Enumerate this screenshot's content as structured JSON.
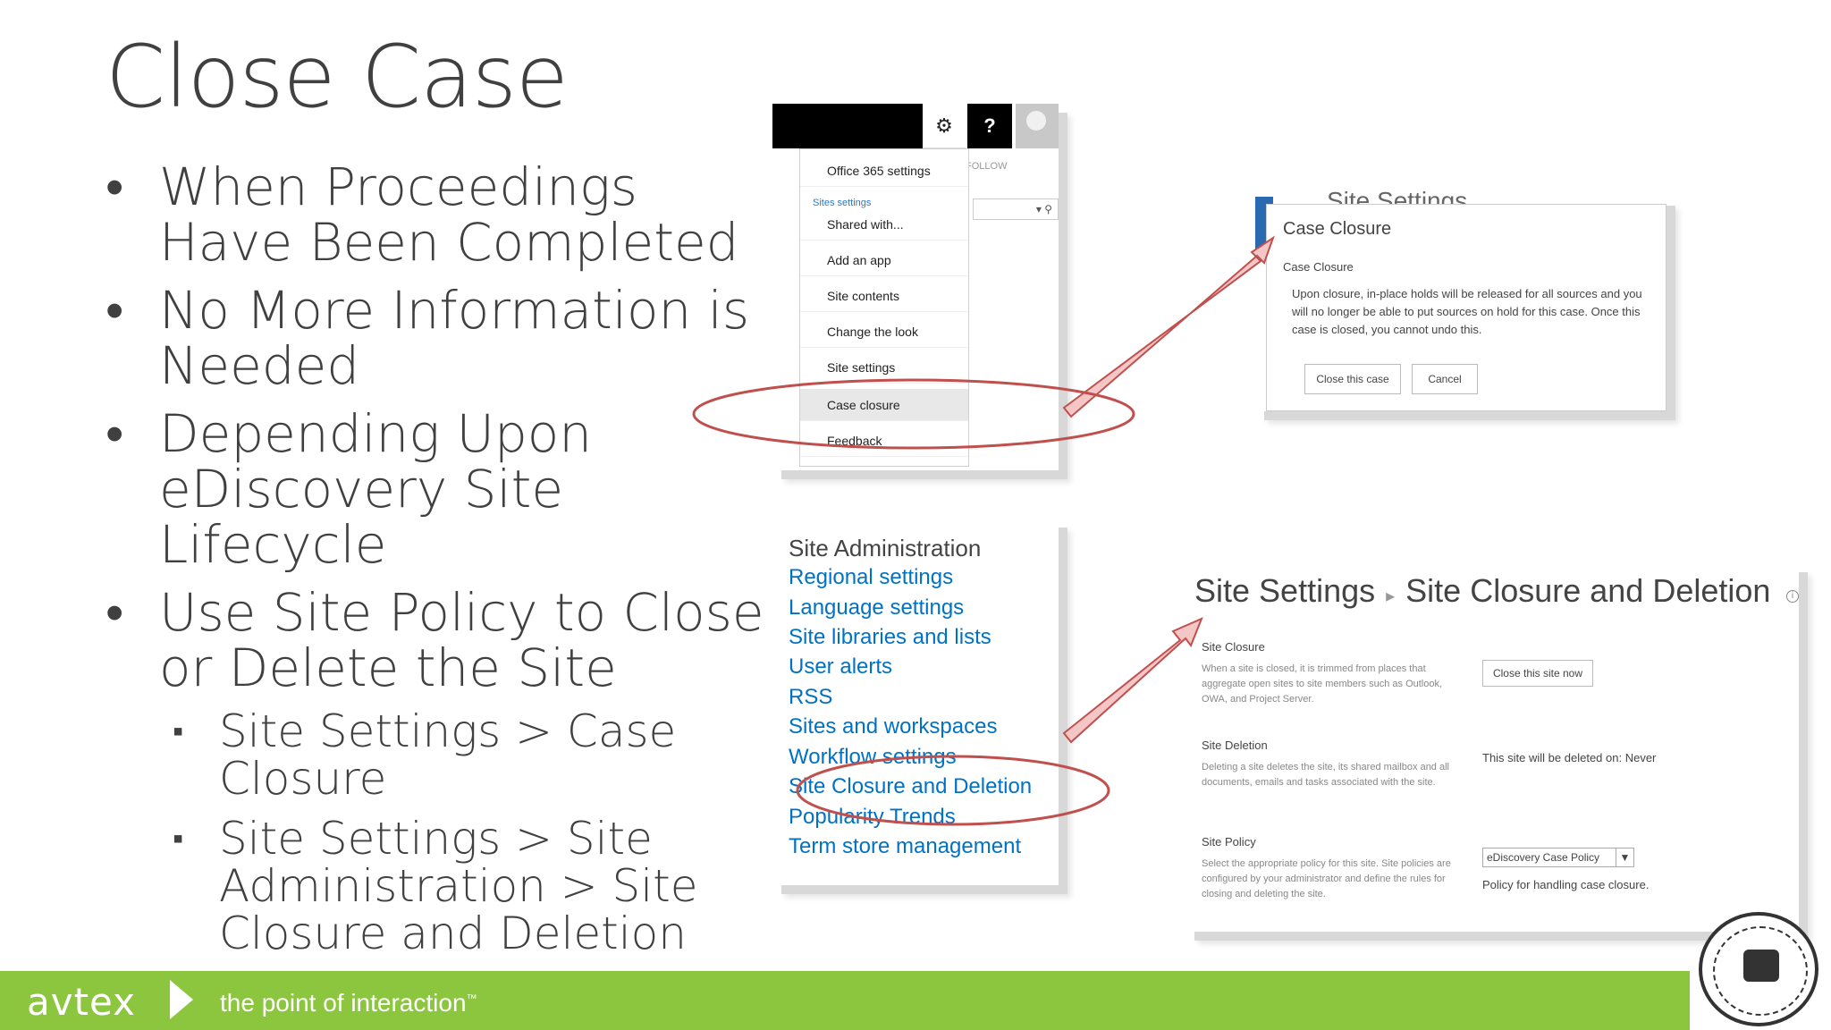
{
  "slide": {
    "title": "Close Case",
    "bullets": [
      "When Proceedings Have Been Completed",
      "No More Information is Needed",
      "Depending Upon eDiscovery Site Lifecycle",
      "Use Site Policy to Close or Delete the Site"
    ],
    "sub_bullets": [
      "Site Settings > Case Closure",
      "Site Settings > Site Administration > Site Closure and Deletion"
    ]
  },
  "footer": {
    "logo": "avtex",
    "tagline": "the point of interaction",
    "tm": "™",
    "color": "#8cc63f"
  },
  "settings_menu": {
    "gear_icon": "gear-icon",
    "help_label": "?",
    "follow_label": "FOLLOW",
    "items": [
      "Office 365 settings",
      "Sites settings",
      "Shared with...",
      "Add an app",
      "Site contents",
      "Change the look",
      "Site settings",
      "Case closure",
      "Feedback"
    ]
  },
  "case_closure_dialog": {
    "background_title": "Site Settings",
    "title": "Case Closure",
    "subtitle": "Case Closure",
    "body": "Upon closure, in-place holds will be released for all sources and you will no longer be able to put sources on hold for this case. Once this case is closed, you cannot undo this.",
    "confirm_button": "Close this case",
    "cancel_button": "Cancel"
  },
  "site_administration": {
    "heading": "Site Administration",
    "links": [
      "Regional settings",
      "Language settings",
      "Site libraries and lists",
      "User alerts",
      "RSS",
      "Sites and workspaces",
      "Workflow settings",
      "Site Closure and Deletion",
      "Popularity Trends",
      "Term store management"
    ],
    "link_color": "#0072c6"
  },
  "site_closure": {
    "breadcrumb_root": "Site Settings",
    "breadcrumb_page": "Site Closure and Deletion",
    "closure_heading": "Site Closure",
    "closure_desc": "When a site is closed, it is trimmed from places that aggregate open sites to site members such as Outlook, OWA, and Project Server.",
    "close_button": "Close this site now",
    "deletion_heading": "Site Deletion",
    "deletion_desc": "Deleting a site deletes the site, its shared mailbox and all documents, emails and tasks associated with the site.",
    "deletion_value": "This site will be deleted on: Never",
    "policy_heading": "Site Policy",
    "policy_desc": "Select the appropriate policy for this site. Site policies are configured by your administrator and define the rules for closing and deleting the site.",
    "policy_selected": "eDiscovery Case Policy",
    "policy_note": "Policy for handling case closure."
  },
  "annotations": {
    "highlight_color": "#c0504d",
    "arrow_fill": "#f4c7c6"
  }
}
